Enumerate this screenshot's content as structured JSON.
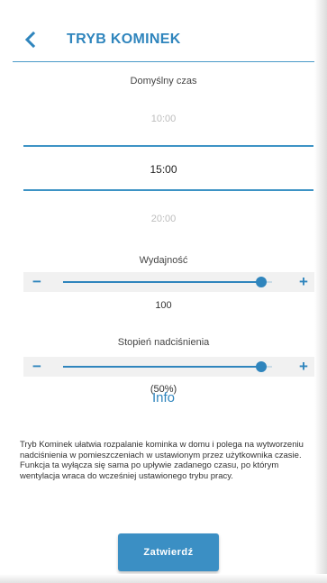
{
  "header": {
    "title": "TRYB KOMINEK"
  },
  "time_picker": {
    "label": "Domyślny czas",
    "option_above": "10:00",
    "selected": "15:00",
    "option_below": "20:00"
  },
  "efficiency": {
    "label": "Wydajność",
    "minus_symbol": "−",
    "plus_symbol": "+",
    "value": "100",
    "fill_fraction": 0.95
  },
  "overpressure": {
    "label": "Stopień nadciśnienia",
    "minus_symbol": "−",
    "plus_symbol": "+",
    "value": "(50%)",
    "fill_fraction": 0.95
  },
  "info": {
    "heading": "Info",
    "text": "Tryb Kominek ułatwia rozpalanie kominka w domu i polega na wytworzeniu nadciśnienia w pomieszczeniach w ustawionym przez użytkownika czasie. Funkcja ta wyłącza się sama po upływie zadanego czasu, po którym wentylacja wraca do wcześniej ustawionego trybu pracy."
  },
  "confirm": {
    "label": "Zatwierdź"
  },
  "colors": {
    "accent": "#2f85bd",
    "button": "#3b8fc4"
  },
  "icons": {
    "back": "chevron-left-icon"
  }
}
